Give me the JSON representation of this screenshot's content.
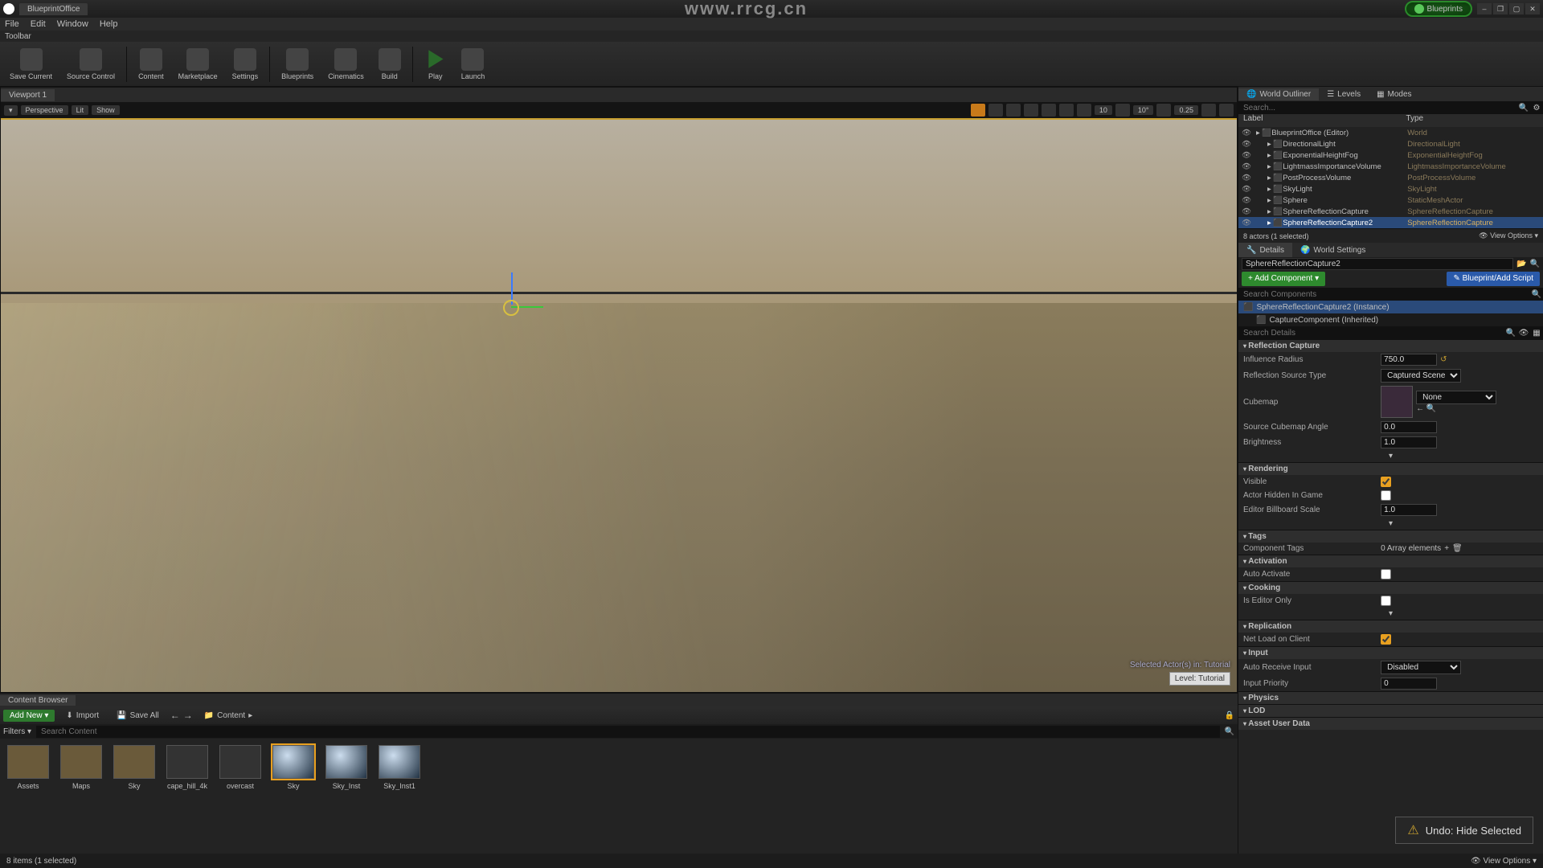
{
  "app": {
    "tab": "BlueprintOffice",
    "watermark": "www.rrcg.cn"
  },
  "blueprints_badge": "Blueprints",
  "window_controls": {
    "min": "–",
    "restore": "❐",
    "max": "▢",
    "close": "✕"
  },
  "menubar": [
    "File",
    "Edit",
    "Window",
    "Help"
  ],
  "toolbar_label": "Toolbar",
  "toolbar": [
    {
      "label": "Save Current"
    },
    {
      "label": "Source Control"
    },
    {
      "label": "Content"
    },
    {
      "label": "Marketplace"
    },
    {
      "label": "Settings"
    },
    {
      "label": "Blueprints"
    },
    {
      "label": "Cinematics"
    },
    {
      "label": "Build"
    },
    {
      "label": "Play"
    },
    {
      "label": "Launch"
    }
  ],
  "viewport": {
    "tab": "Viewport 1",
    "left_pills": [
      "▾",
      "Perspective",
      "Lit",
      "Show"
    ],
    "right_vals": {
      "grid": "10",
      "angle": "10°",
      "scale": "0.25"
    },
    "sel_text": "Selected Actor(s) in:\nTutorial",
    "level_badge": "Level: Tutorial"
  },
  "outliner": {
    "tabs": [
      "World Outliner",
      "Levels",
      "Modes"
    ],
    "search_ph": "Search...",
    "cols": [
      "Label",
      "Type"
    ],
    "rows": [
      {
        "d": 0,
        "n": "BlueprintOffice (Editor)",
        "t": "World"
      },
      {
        "d": 1,
        "n": "DirectionalLight",
        "t": "DirectionalLight"
      },
      {
        "d": 1,
        "n": "ExponentialHeightFog",
        "t": "ExponentialHeightFog"
      },
      {
        "d": 1,
        "n": "LightmassImportanceVolume",
        "t": "LightmassImportanceVolume"
      },
      {
        "d": 1,
        "n": "PostProcessVolume",
        "t": "PostProcessVolume"
      },
      {
        "d": 1,
        "n": "SkyLight",
        "t": "SkyLight"
      },
      {
        "d": 1,
        "n": "Sphere",
        "t": "StaticMeshActor"
      },
      {
        "d": 1,
        "n": "SphereReflectionCapture",
        "t": "SphereReflectionCapture"
      },
      {
        "d": 1,
        "n": "SphereReflectionCapture2",
        "t": "SphereReflectionCapture",
        "sel": true
      }
    ],
    "foot_left": "8 actors (1 selected)",
    "foot_right": "View Options ▾"
  },
  "details": {
    "tabs": [
      "Details",
      "World Settings"
    ],
    "obj_name": "SphereReflectionCapture2",
    "add_component": "+ Add Component ▾",
    "bp_script": "Blueprint/Add Script",
    "search_comp_ph": "Search Components",
    "components": [
      {
        "n": "SphereReflectionCapture2 (Instance)",
        "sel": true
      },
      {
        "n": "CaptureComponent (Inherited)"
      }
    ],
    "search_det_ph": "Search Details",
    "sections": {
      "reflection": {
        "h": "Reflection Capture",
        "props": {
          "influence_radius": {
            "l": "Influence Radius",
            "v": "750.0"
          },
          "reflection_source_type": {
            "l": "Reflection Source Type",
            "v": "Captured Scene"
          },
          "cubemap": {
            "l": "Cubemap",
            "v": "None"
          },
          "source_cubemap_angle": {
            "l": "Source Cubemap Angle",
            "v": "0.0"
          },
          "brightness": {
            "l": "Brightness",
            "v": "1.0"
          }
        }
      },
      "rendering": {
        "h": "Rendering",
        "props": {
          "visible": {
            "l": "Visible",
            "v": true
          },
          "actor_hidden": {
            "l": "Actor Hidden In Game",
            "v": false
          },
          "billboard_scale": {
            "l": "Editor Billboard Scale",
            "v": "1.0"
          }
        }
      },
      "tags": {
        "h": "Tags",
        "props": {
          "component_tags": {
            "l": "Component Tags",
            "v": "0 Array elements"
          }
        }
      },
      "activation": {
        "h": "Activation",
        "props": {
          "auto_activate": {
            "l": "Auto Activate",
            "v": false
          }
        }
      },
      "cooking": {
        "h": "Cooking",
        "props": {
          "editor_only": {
            "l": "Is Editor Only",
            "v": false
          }
        }
      },
      "replication": {
        "h": "Replication",
        "props": {
          "net_load": {
            "l": "Net Load on Client",
            "v": true
          }
        }
      },
      "input": {
        "h": "Input",
        "props": {
          "auto_receive": {
            "l": "Auto Receive Input",
            "v": "Disabled"
          },
          "priority": {
            "l": "Input Priority",
            "v": "0"
          }
        }
      },
      "physics": {
        "h": "Physics"
      },
      "lod": {
        "h": "LOD"
      },
      "asset": {
        "h": "Asset User Data"
      }
    }
  },
  "content_browser": {
    "tab": "Content Browser",
    "add_new": "Add New ▾",
    "import": "Import",
    "save_all": "Save All",
    "path": "Content",
    "filters": "Filters ▾",
    "search_ph": "Search Content",
    "items": [
      {
        "n": "Assets",
        "k": "folder"
      },
      {
        "n": "Maps",
        "k": "folder"
      },
      {
        "n": "Sky",
        "k": "folder"
      },
      {
        "n": "cape_hill_4k",
        "k": "tex"
      },
      {
        "n": "overcast",
        "k": "tex"
      },
      {
        "n": "Sky",
        "k": "sphere",
        "sel": true
      },
      {
        "n": "Sky_Inst",
        "k": "sphere"
      },
      {
        "n": "Sky_Inst1",
        "k": "sphere"
      }
    ],
    "status": "8 items (1 selected)",
    "view_opts": "View Options ▾"
  },
  "toast": "Undo: Hide Selected"
}
